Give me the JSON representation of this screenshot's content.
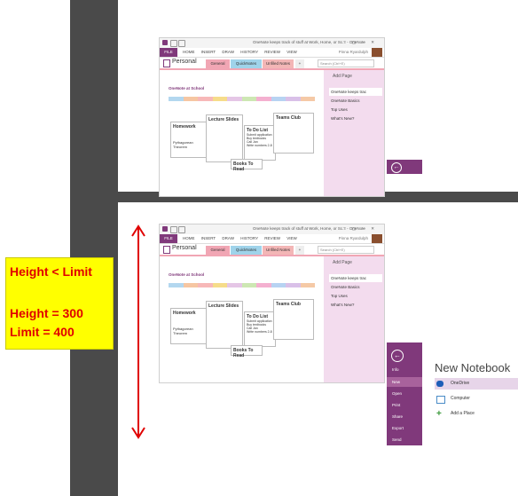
{
  "annotation": {
    "line1": "Height < Limit",
    "line2": "Height = 300",
    "line3": "Limit = 400"
  },
  "onenote": {
    "title": "OneNote keeps track of stuff at Work, Home, or Sc... - OneNote",
    "ribbon_tabs": [
      "FILE",
      "HOME",
      "INSERT",
      "DRAW",
      "HISTORY",
      "REVIEW",
      "VIEW"
    ],
    "user": "Pinna Ryardulph",
    "notebook": "Personal",
    "section_tabs": [
      "General",
      "QuickNotes",
      "Unfiled Notes",
      "+"
    ],
    "search": "Search (Ctrl+E)",
    "page_title": "OneNote at School",
    "boxes": {
      "homework": "Homework",
      "lecture": "Lecture Slides",
      "todo": "To Do List",
      "todo_items": [
        "Submit application",
        "Buy textbooks",
        "Call Jan",
        "Write numbers 2-8"
      ],
      "tearsclub": "Teams Club",
      "books": "Books To Read",
      "pythagorean": "Pythagorean Theorem"
    },
    "pages_panel": {
      "add": "Add Page",
      "pages": [
        "OneNote keeps trac",
        "OneNote Basics",
        "Top Uses",
        "What's New?"
      ]
    }
  },
  "backstage": {
    "back": "←",
    "nav": [
      "Info",
      "New",
      "Open",
      "Print",
      "Share",
      "Export",
      "Send"
    ],
    "heading": "New Notebook",
    "options": [
      "OneDrive",
      "Computer",
      "Add a Place"
    ]
  },
  "colors": {
    "accent": "#80397b",
    "annotation_bg": "#ffff00",
    "annotation_text": "#e00000",
    "dark_bar": "#4a4a4a"
  }
}
